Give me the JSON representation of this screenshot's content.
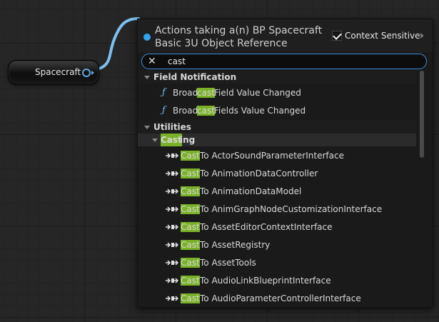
{
  "graph": {
    "node": {
      "label": "Spacecraft"
    }
  },
  "menu": {
    "title_line1": "Actions taking a(n) BP Spacecraft",
    "title_line2": "Basic 3U Object Reference",
    "context_sensitive_label": "Context Sensitive",
    "context_sensitive_checked": true,
    "search_value": "cast",
    "search_clear_icon": "✕",
    "categories": [
      {
        "label": "Field Notification",
        "items": [
          {
            "pre": "Broad",
            "hl": "cast",
            "post": " Field Value Changed",
            "icon": "function-icon"
          },
          {
            "pre": "Broad",
            "hl": "cast",
            "post": " Fields Value Changed",
            "icon": "function-icon"
          }
        ]
      },
      {
        "label": "Utilities",
        "subcategory": {
          "hl": "Cast",
          "post": "ing"
        },
        "items": [
          {
            "hl": "Cast",
            "post": " To ActorSoundParameterInterface"
          },
          {
            "hl": "Cast",
            "post": " To AnimationDataController"
          },
          {
            "hl": "Cast",
            "post": " To AnimationDataModel"
          },
          {
            "hl": "Cast",
            "post": " To AnimGraphNodeCustomizationInterface"
          },
          {
            "hl": "Cast",
            "post": " To AssetEditorContextInterface"
          },
          {
            "hl": "Cast",
            "post": " To AssetRegistry"
          },
          {
            "hl": "Cast",
            "post": " To AssetTools"
          },
          {
            "hl": "Cast",
            "post": " To AudioLinkBlueprintInterface"
          },
          {
            "hl": "Cast",
            "post": " To AudioParameterControllerInterface"
          }
        ]
      }
    ]
  },
  "colors": {
    "highlight": "#7ab227",
    "accent": "#3b8fd8",
    "pin": "#62a7e8"
  }
}
